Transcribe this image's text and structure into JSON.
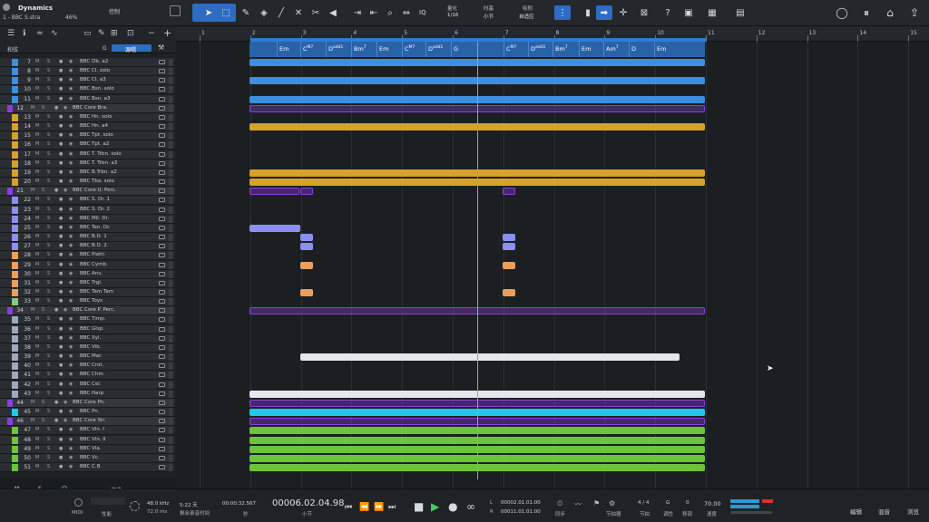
{
  "project": {
    "title": "Dynamics",
    "track": "1 - BBC S.stra",
    "zoom": "46%",
    "panel": "控制"
  },
  "toolbar": {
    "quantize_label": "IQ",
    "quantize": {
      "label": "量化",
      "value": "1/16"
    },
    "timebase": {
      "label": "时基",
      "value": "小节"
    },
    "snap": {
      "label": "吸附",
      "value": "自适应"
    }
  },
  "trackheader": {
    "group_label": "和弦",
    "g_label": "G",
    "tag_label": "源唱"
  },
  "ruler": [
    "1",
    "2",
    "3",
    "4",
    "5",
    "6",
    "7",
    "8",
    "9",
    "10",
    "11",
    "12",
    "13",
    "14",
    "15"
  ],
  "chords": [
    "Em",
    "C",
    "D",
    "Bm",
    "Em",
    "C",
    "D",
    "G",
    "C",
    "D",
    "Bm",
    "Em",
    "Am",
    "D",
    "Em"
  ],
  "chord_sup": [
    "",
    "M7",
    "add1",
    "7",
    "",
    "M7",
    "add1",
    "",
    "M7",
    "add1",
    "7",
    "",
    "7",
    "",
    ""
  ],
  "tracks": [
    {
      "num": "7",
      "name": "BBC Ob. a2",
      "color": "#3c8fe0",
      "folder": false
    },
    {
      "num": "8",
      "name": "BBC Cl. solo",
      "color": "#3c8fe0",
      "folder": false
    },
    {
      "num": "9",
      "name": "BBC Cl. a3",
      "color": "#3c8fe0",
      "folder": false
    },
    {
      "num": "10",
      "name": "BBC Bsn. solo",
      "color": "#3c8fe0",
      "folder": false
    },
    {
      "num": "11",
      "name": "BBC Bsn. a3",
      "color": "#3c8fe0",
      "folder": false
    },
    {
      "num": "12",
      "name": "BBC Core Bra.",
      "color": "#8a3ee0",
      "folder": true
    },
    {
      "num": "13",
      "name": "BBC Hn. solo",
      "color": "#d6a22a",
      "folder": false
    },
    {
      "num": "14",
      "name": "BBC Hn. a4",
      "color": "#d6a22a",
      "folder": false
    },
    {
      "num": "15",
      "name": "BBC Tpt. solo",
      "color": "#d6a22a",
      "folder": false
    },
    {
      "num": "16",
      "name": "BBC Tpt. a2",
      "color": "#d6a22a",
      "folder": false
    },
    {
      "num": "17",
      "name": "BBC T. Trbn. solo",
      "color": "#d6a22a",
      "folder": false
    },
    {
      "num": "18",
      "name": "BBC T. Trbn. a3",
      "color": "#d6a22a",
      "folder": false
    },
    {
      "num": "19",
      "name": "BBC B.Trbn. a2",
      "color": "#d6a22a",
      "folder": false
    },
    {
      "num": "20",
      "name": "BBC Tba. solo",
      "color": "#d6a22a",
      "folder": false
    },
    {
      "num": "21",
      "name": "BBC Core U. Perc.",
      "color": "#8a3ee0",
      "folder": true
    },
    {
      "num": "22",
      "name": "BBC S. Dr. 1",
      "color": "#8c8ff0",
      "folder": false
    },
    {
      "num": "23",
      "name": "BBC S. Dr. 2",
      "color": "#8c8ff0",
      "folder": false
    },
    {
      "num": "24",
      "name": "BBC Mil. Dr.",
      "color": "#8c8ff0",
      "folder": false
    },
    {
      "num": "25",
      "name": "BBC Ten. Dr.",
      "color": "#8c8ff0",
      "folder": false
    },
    {
      "num": "26",
      "name": "BBC B.D. 1",
      "color": "#8c8ff0",
      "folder": false
    },
    {
      "num": "27",
      "name": "BBC B.D. 2",
      "color": "#8c8ff0",
      "folder": false
    },
    {
      "num": "28",
      "name": "BBC Piatti",
      "color": "#e8a060",
      "folder": false
    },
    {
      "num": "29",
      "name": "BBC Cymb.",
      "color": "#e8a060",
      "folder": false
    },
    {
      "num": "30",
      "name": "BBC Anv.",
      "color": "#e8a060",
      "folder": false
    },
    {
      "num": "31",
      "name": "BBC Trgl.",
      "color": "#e8a060",
      "folder": false
    },
    {
      "num": "32",
      "name": "BBC Tam Tam",
      "color": "#e8a060",
      "folder": false
    },
    {
      "num": "33",
      "name": "BBC Toys",
      "color": "#7fd07a",
      "folder": false
    },
    {
      "num": "34",
      "name": "BBC Core P. Perc.",
      "color": "#8a3ee0",
      "folder": true
    },
    {
      "num": "35",
      "name": "BBC Timp.",
      "color": "#a0a8c0",
      "folder": false
    },
    {
      "num": "36",
      "name": "BBC Glsp.",
      "color": "#a0a8c0",
      "folder": false
    },
    {
      "num": "37",
      "name": "BBC Xyl.",
      "color": "#a0a8c0",
      "folder": false
    },
    {
      "num": "38",
      "name": "BBC Vib.",
      "color": "#a0a8c0",
      "folder": false
    },
    {
      "num": "39",
      "name": "BBC Mar.",
      "color": "#a0a8c0",
      "folder": false
    },
    {
      "num": "40",
      "name": "BBC Crot.",
      "color": "#a0a8c0",
      "folder": false
    },
    {
      "num": "41",
      "name": "BBC Chm.",
      "color": "#a0a8c0",
      "folder": false
    },
    {
      "num": "42",
      "name": "BBC Cel.",
      "color": "#a0a8c0",
      "folder": false
    },
    {
      "num": "43",
      "name": "BBC Harp",
      "color": "#a0a8c0",
      "folder": false
    },
    {
      "num": "44",
      "name": "BBC Core Pn.",
      "color": "#8a3ee0",
      "folder": true
    },
    {
      "num": "45",
      "name": "BBC Pn.",
      "color": "#22c8e8",
      "folder": false
    },
    {
      "num": "46",
      "name": "BBC Core Str.",
      "color": "#8a3ee0",
      "folder": true
    },
    {
      "num": "47",
      "name": "BBC Vln. I",
      "color": "#6cc43a",
      "folder": false
    },
    {
      "num": "48",
      "name": "BBC Vln. II",
      "color": "#6cc43a",
      "folder": false
    },
    {
      "num": "49",
      "name": "BBC Vla.",
      "color": "#6cc43a",
      "folder": false
    },
    {
      "num": "50",
      "name": "BBC Vc.",
      "color": "#6cc43a",
      "folder": false
    },
    {
      "num": "51",
      "name": "BBC C.B.",
      "color": "#6cc43a",
      "folder": false
    }
  ],
  "listfooter": {
    "m": "M",
    "s": "S",
    "mode": "概览"
  },
  "status": {
    "midi": "MIDI",
    "perf": "性能",
    "samplerate": "48.0 kHz",
    "latency": "72.0 ms",
    "remaining": "5:22 天",
    "remaining_label": "剩余录音时间",
    "seconds": "00:00:32.567",
    "seconds_unit": "秒",
    "position": "00006.02.04.98",
    "position_unit": "小节",
    "loop_start": "00002.01.01.00",
    "loop_end": "00011.01.01.00",
    "sync": "同步",
    "metronome": "节拍器",
    "timesig": "4 / 4",
    "timesig_label": "节拍",
    "key": "G",
    "key_label": "调性",
    "shift": "0",
    "shift_label": "移调",
    "tempo": "70.00",
    "tempo_label": "速度",
    "edit": "编辑",
    "mix": "混音",
    "browse": "浏览"
  }
}
